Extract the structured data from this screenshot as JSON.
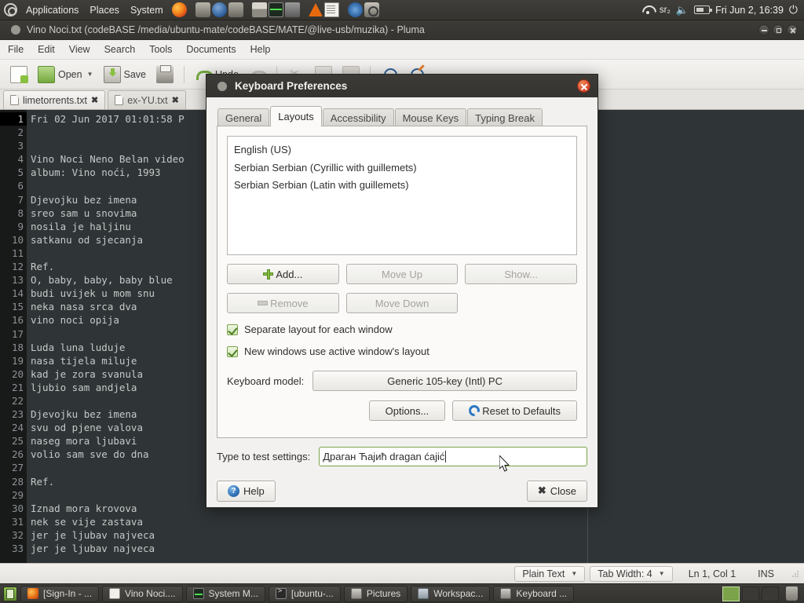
{
  "top_panel": {
    "logo_icon": "mate-logo-icon",
    "menus": [
      "Applications",
      "Places",
      "System"
    ],
    "launchers": [
      {
        "name": "firefox-icon"
      },
      {
        "name": "gnome-disk-icon"
      },
      {
        "name": "gparted-icon"
      },
      {
        "name": "disk-usage-icon"
      },
      {
        "name": "archive-manager-icon"
      },
      {
        "name": "system-monitor-icon"
      },
      {
        "name": "tool-icon"
      },
      {
        "name": "vlc-icon"
      },
      {
        "name": "pluma-icon"
      },
      {
        "name": "shotwell-icon"
      },
      {
        "name": "camera-icon"
      }
    ],
    "tray": {
      "wifi_icon": "wifi-icon",
      "keyboard_indicator": "sr₂",
      "volume_icon": "volume-icon",
      "battery_icon": "battery-icon",
      "power_icon": "power-icon"
    },
    "clock": "Fri Jun 2, 16:39"
  },
  "pluma": {
    "title": "Vino Noci.txt (codeBASE /media/ubuntu-mate/codeBASE/MATE/@live-usb/muzika) - Pluma",
    "window_buttons": {
      "minimize": "minimize-button",
      "maximize": "maximize-button",
      "close": "close-button"
    },
    "menubar": [
      "File",
      "Edit",
      "View",
      "Search",
      "Tools",
      "Documents",
      "Help"
    ],
    "toolbar": {
      "new_label": "",
      "open_label": "Open",
      "save_label": "Save",
      "print_label": "",
      "undo_label": "Undo",
      "redo_label": ""
    },
    "tabs": [
      {
        "label": "limetorrents.txt",
        "active": true,
        "closable": true
      },
      {
        "label": "ex-YU.txt",
        "active": false,
        "closable": true
      }
    ],
    "document_lines": [
      "Fri 02 Jun 2017 01:01:58 P",
      "",
      "",
      "Vino Noci Neno Belan video",
      "album: Vino noći, 1993",
      "",
      "Djevojku bez imena",
      "sreo sam u snovima",
      "nosila je haljinu",
      "satkanu od sjecanja",
      "",
      "Ref.",
      "O, baby, baby, baby blue",
      "budi uvijek u mom snu",
      "neka nasa srca dva",
      "vino noci opija",
      "",
      "Luda luna luduje",
      "nasa tijela miluje",
      "kad je zora svanula",
      "ljubio sam andjela",
      "",
      "Djevojku bez imena",
      "svu od pjene valova",
      "naseg mora ljubavi",
      "volio sam sve do dna",
      "",
      "Ref.",
      "",
      "Iznad mora krovova",
      "nek se vije zastava",
      "jer je ljubav najveca",
      "jer je ljubav najveca"
    ],
    "statusbar": {
      "language": "Plain Text",
      "tab_width": "Tab Width: 4",
      "position": "Ln 1, Col 1",
      "insert_mode": "INS"
    }
  },
  "dialog": {
    "title": "Keyboard Preferences",
    "close_icon": "close-icon",
    "tabs": [
      {
        "label": "General",
        "active": false
      },
      {
        "label": "Layouts",
        "active": true
      },
      {
        "label": "Accessibility",
        "active": false
      },
      {
        "label": "Mouse Keys",
        "active": false
      },
      {
        "label": "Typing Break",
        "active": false
      }
    ],
    "layouts": [
      "English (US)",
      "Serbian Serbian (Cyrillic with guillemets)",
      "Serbian Serbian (Latin with guillemets)"
    ],
    "buttons": {
      "add": "Add...",
      "move_up": "Move Up",
      "show": "Show...",
      "remove": "Remove",
      "move_down": "Move Down",
      "options": "Options...",
      "reset": "Reset to Defaults",
      "help": "Help",
      "close": "Close"
    },
    "checkboxes": [
      {
        "label": "Separate layout for each window",
        "checked": true
      },
      {
        "label": "New windows use active window's layout",
        "checked": true
      }
    ],
    "keyboard_model": {
      "label": "Keyboard model:",
      "value": "Generic 105-key (Intl) PC"
    },
    "test_field": {
      "label": "Type to test settings:",
      "value": "Драган Ћајић  dragan ćajić"
    }
  },
  "taskbar": {
    "show_desktop": "show-desktop-button",
    "tasks": [
      {
        "label": "[Sign-In - ...",
        "icon": "firefox-icon"
      },
      {
        "label": "Vino Noci....",
        "icon": "pluma-icon"
      },
      {
        "label": "System M...",
        "icon": "system-monitor-icon"
      },
      {
        "label": "[ubuntu-...",
        "icon": "terminal-icon"
      },
      {
        "label": "Pictures",
        "icon": "folder-icon"
      },
      {
        "label": "Workspac...",
        "icon": "workspace-icon"
      },
      {
        "label": "Keyboard ...",
        "icon": "keyboard-icon"
      }
    ],
    "workspaces": [
      {
        "active": true
      },
      {
        "active": false
      },
      {
        "active": false
      }
    ],
    "trash_icon": "trash-icon"
  },
  "colors": {
    "panel_bg": "#3a3936",
    "editor_bg": "#2f3436",
    "gutter_bg": "#181a1a",
    "accent_green": "#7aa34a",
    "dialog_bg": "#f2f1ef"
  }
}
